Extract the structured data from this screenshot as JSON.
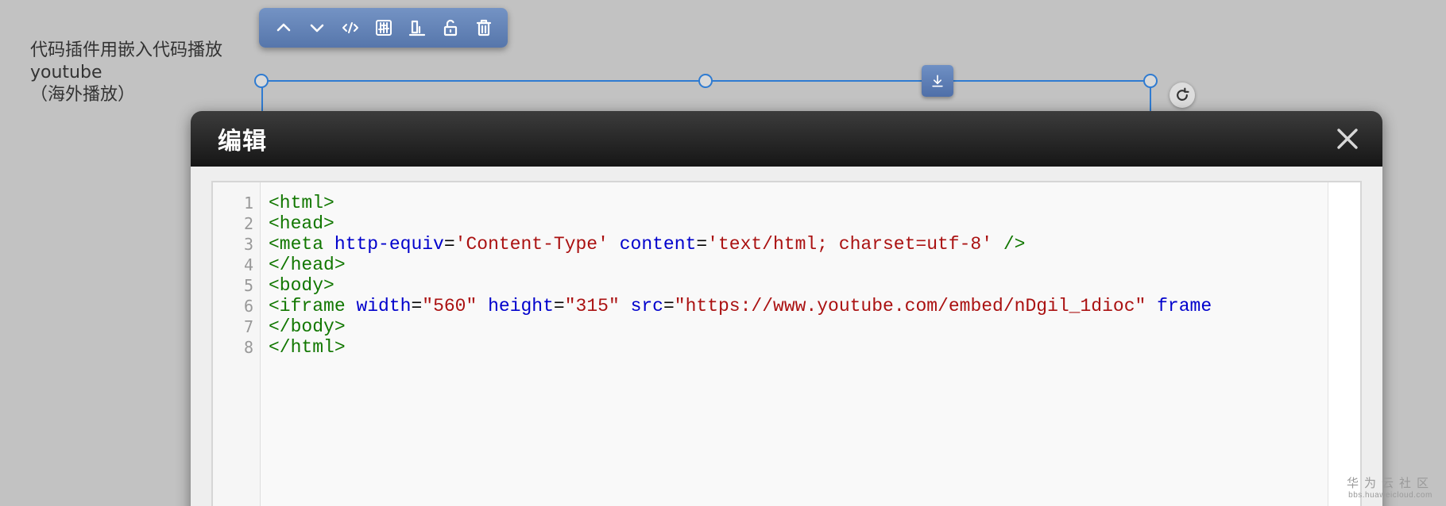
{
  "side_label": {
    "line1": "代码插件用嵌入代码播放",
    "line2": "youtube",
    "line3": "（海外播放）"
  },
  "toolbar": {
    "icons": [
      "chevron-up-icon",
      "chevron-down-icon",
      "code-icon",
      "sliders-icon",
      "chart-icon",
      "unlock-icon",
      "trash-icon"
    ],
    "color": "#6383b8"
  },
  "selection": {
    "accent": "#2f7bd1"
  },
  "modal": {
    "title": "编辑",
    "close_icon": "close-icon"
  },
  "editor": {
    "line_numbers": [
      "1",
      "2",
      "3",
      "4",
      "5",
      "6",
      "7",
      "8"
    ],
    "lines": [
      [
        {
          "t": "tg",
          "v": "<html>"
        }
      ],
      [
        {
          "t": "tg",
          "v": "<head>"
        }
      ],
      [
        {
          "t": "tg",
          "v": "<meta"
        },
        {
          "t": "pl",
          "v": " "
        },
        {
          "t": "at",
          "v": "http-equiv"
        },
        {
          "t": "pl",
          "v": "="
        },
        {
          "t": "st",
          "v": "'Content-Type'"
        },
        {
          "t": "pl",
          "v": " "
        },
        {
          "t": "at",
          "v": "content"
        },
        {
          "t": "pl",
          "v": "="
        },
        {
          "t": "st",
          "v": "'text/html; charset=utf-8'"
        },
        {
          "t": "pl",
          "v": " "
        },
        {
          "t": "tg",
          "v": "/>"
        }
      ],
      [
        {
          "t": "tg",
          "v": "</head>"
        }
      ],
      [
        {
          "t": "tg",
          "v": "<body>"
        }
      ],
      [
        {
          "t": "tg",
          "v": "<iframe"
        },
        {
          "t": "pl",
          "v": " "
        },
        {
          "t": "at",
          "v": "width"
        },
        {
          "t": "pl",
          "v": "="
        },
        {
          "t": "st",
          "v": "\"560\""
        },
        {
          "t": "pl",
          "v": " "
        },
        {
          "t": "at",
          "v": "height"
        },
        {
          "t": "pl",
          "v": "="
        },
        {
          "t": "st",
          "v": "\"315\""
        },
        {
          "t": "pl",
          "v": " "
        },
        {
          "t": "at",
          "v": "src"
        },
        {
          "t": "pl",
          "v": "="
        },
        {
          "t": "st",
          "v": "\"https://www.youtube.com/embed/nDgil_1dioc\""
        },
        {
          "t": "pl",
          "v": " "
        },
        {
          "t": "at",
          "v": "frame"
        }
      ],
      [
        {
          "t": "tg",
          "v": "</body>"
        }
      ],
      [
        {
          "t": "tg",
          "v": "</html>"
        }
      ]
    ],
    "colors": {
      "tag": "#117700",
      "attribute": "#0000cc",
      "string": "#aa1111"
    }
  },
  "watermark": {
    "main": "华为云社区",
    "sub": "bbs.huaweicloud.com"
  }
}
